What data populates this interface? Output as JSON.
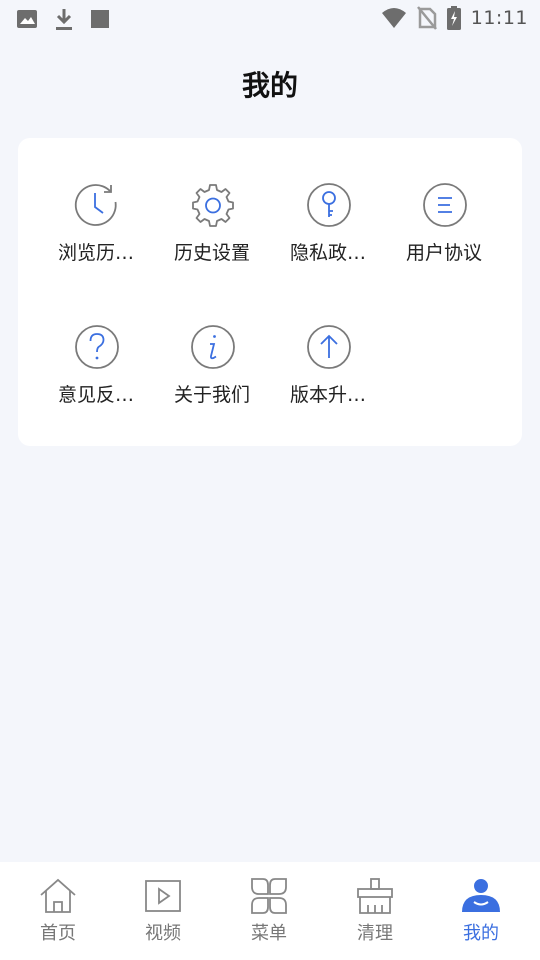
{
  "status_bar": {
    "time": "11:11",
    "left_icons": [
      "image-icon",
      "download-icon",
      "stop-icon"
    ],
    "right_icons": [
      "wifi-icon",
      "no-sim-icon",
      "battery-charging-icon"
    ]
  },
  "header": {
    "title": "我的"
  },
  "menu": {
    "items": [
      {
        "label": "浏览历…",
        "icon": "history-icon"
      },
      {
        "label": "历史设置",
        "icon": "gear-icon"
      },
      {
        "label": "隐私政…",
        "icon": "key-icon"
      },
      {
        "label": "用户协议",
        "icon": "list-icon"
      },
      {
        "label": "意见反…",
        "icon": "question-icon"
      },
      {
        "label": "关于我们",
        "icon": "info-icon"
      },
      {
        "label": "版本升…",
        "icon": "upgrade-icon"
      }
    ]
  },
  "nav": {
    "active": "我的",
    "tabs": [
      {
        "label": "首页",
        "icon": "home-icon"
      },
      {
        "label": "视频",
        "icon": "video-icon"
      },
      {
        "label": "菜单",
        "icon": "menu-grid-icon"
      },
      {
        "label": "清理",
        "icon": "broom-icon"
      },
      {
        "label": "我的",
        "icon": "user-icon"
      }
    ]
  },
  "colors": {
    "accent": "#3b6fe0",
    "icon_gray": "#7a7a7a",
    "background": "#f4f6fb"
  }
}
